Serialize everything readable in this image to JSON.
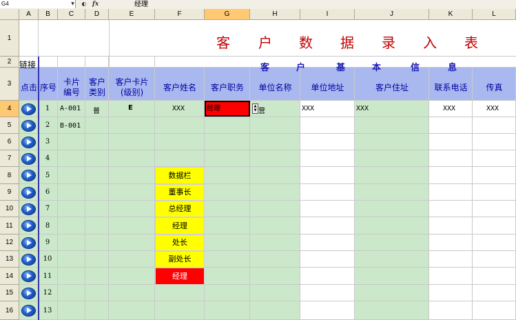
{
  "formula_bar": {
    "name_box": "G4",
    "fx": "fx",
    "value": "经理"
  },
  "columns": [
    "A",
    "B",
    "C",
    "D",
    "E",
    "F",
    "G",
    "H",
    "I",
    "J",
    "K",
    "L"
  ],
  "selected_column": "G",
  "rows": [
    "1",
    "2",
    "3",
    "4",
    "5",
    "6",
    "7",
    "8",
    "9",
    "10",
    "11",
    "12",
    "13",
    "14",
    "15",
    "16"
  ],
  "selected_row": "4",
  "title_chars": [
    "客",
    "户",
    "数",
    "据",
    "录",
    "入",
    "表"
  ],
  "row2": {
    "link": "链接",
    "sub_chars": [
      "客",
      "户",
      "基",
      "本",
      "信",
      "息"
    ]
  },
  "headers": {
    "a": "点击",
    "b": "序号",
    "c1": "卡片",
    "c2": "编号",
    "d1": "客户",
    "d2": "类别",
    "e1": "客户卡片",
    "e2": "(级别)",
    "f": "客户姓名",
    "g": "客户职务",
    "h": "单位名称",
    "i": "单位地址",
    "j": "客户住址",
    "k": "联系电话",
    "l": "传真"
  },
  "seq_numbers": [
    "1",
    "2",
    "3",
    "4",
    "5",
    "6",
    "7",
    "8",
    "9",
    "10",
    "11",
    "12",
    "13"
  ],
  "row4": {
    "card": "A-001",
    "type": "普",
    "level": "E",
    "name": "XXX",
    "position": "经理",
    "company": "营",
    "address": "XXX",
    "home": "XXX",
    "phone": "XXX",
    "fax": "XXX"
  },
  "row5": {
    "card": "B-001"
  },
  "dropdown_list": [
    "数据栏",
    "董事长",
    "总经理",
    "经理",
    "处长",
    "副处长",
    "经理"
  ],
  "colors": {
    "header_blue": "#a9b9f0",
    "green": "#cbe8cb",
    "yellow": "#ffff00",
    "red": "#ff0000",
    "title_red": "#c00000"
  }
}
